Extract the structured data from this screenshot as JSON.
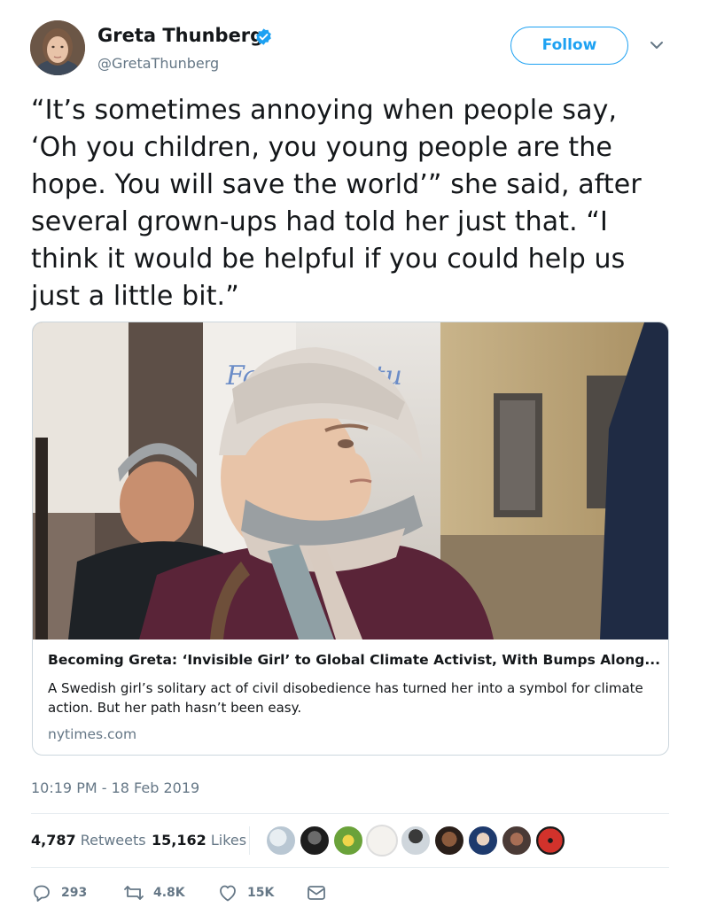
{
  "author": {
    "name": "Greta Thunberg",
    "handle": "@GretaThunberg",
    "verified": true
  },
  "follow_label": "Follow",
  "tweet": {
    "lines": [
      "“It’s sometimes annoying when people say,",
      "‘Oh you children, you young people are the",
      "hope. You will save the world’” she said, after",
      "several grown-ups had told her just that. “I",
      "think it would be helpful if you could help us",
      "just a little bit.”"
    ]
  },
  "card": {
    "title": "Becoming Greta: ‘Invisible Girl’ to Global Climate Activist, With Bumps Along...",
    "description": "A Swedish girl’s solitary act of civil disobedience has turned her into a symbol for climate action. But her path hasn’t been easy.",
    "domain": "nytimes.com",
    "sign_text": "Fath Fu Futu"
  },
  "timestamp": "10:19 PM - 18 Feb 2019",
  "stats": {
    "retweets_count": "4,787",
    "retweets_label": "Retweets",
    "likes_count": "15,162",
    "likes_label": "Likes"
  },
  "actions": {
    "reply_count": "293",
    "retweet_count": "4.8K",
    "like_count": "15K"
  },
  "colors": {
    "accent": "#1da1f2",
    "text": "#14171a",
    "muted": "#657786",
    "border": "#e6ecf0"
  },
  "icons": [
    "verified-badge-icon",
    "chevron-down-icon",
    "reply-icon",
    "retweet-icon",
    "heart-icon",
    "message-icon"
  ]
}
